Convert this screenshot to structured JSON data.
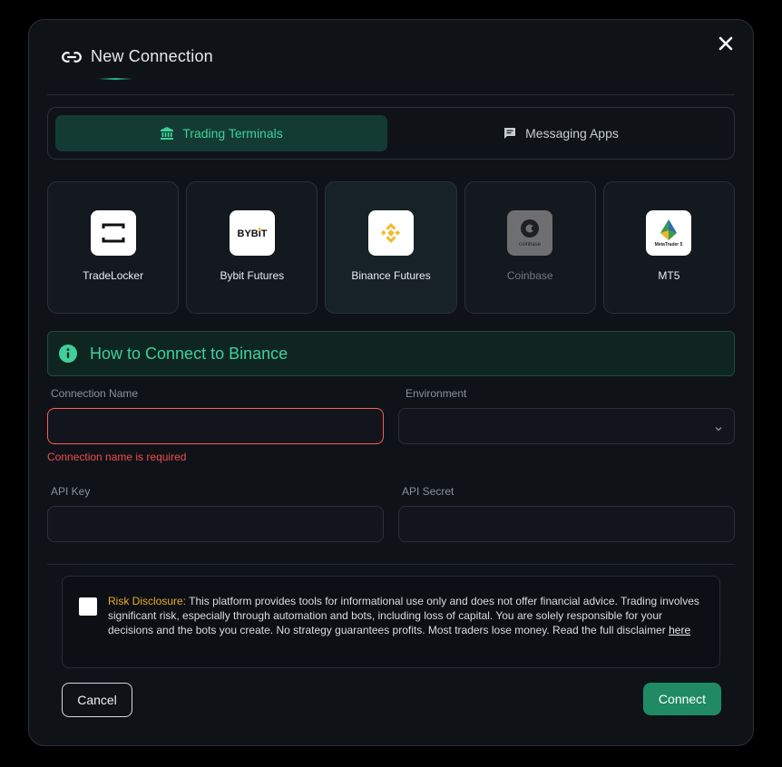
{
  "header": {
    "title": "New Connection",
    "link_icon": "link-icon",
    "close_icon": "close-icon"
  },
  "tabs": [
    {
      "label": "Trading Terminals",
      "icon": "bank-icon",
      "active": true
    },
    {
      "label": "Messaging Apps",
      "icon": "chat-icon",
      "active": false
    }
  ],
  "providers": [
    {
      "name": "TradeLocker",
      "logo": "tradelocker-logo",
      "selected": false,
      "disabled": false
    },
    {
      "name": "Bybit Futures",
      "logo": "bybit-logo",
      "logo_text": "BYBIT",
      "selected": false,
      "disabled": false
    },
    {
      "name": "Binance Futures",
      "logo": "binance-logo",
      "selected": true,
      "disabled": false
    },
    {
      "name": "Coinbase",
      "logo": "coinbase-logo",
      "logo_text": "coinbase",
      "selected": false,
      "disabled": true
    },
    {
      "name": "MT5",
      "logo": "metatrader-logo",
      "logo_text": "MetaTrader 5",
      "selected": false,
      "disabled": false
    }
  ],
  "info_banner": {
    "text": "How to Connect to Binance",
    "icon": "info-icon"
  },
  "form": {
    "connection_name": {
      "label": "Connection Name",
      "value": "",
      "error": "Connection name is required"
    },
    "environment": {
      "label": "Environment",
      "value": ""
    },
    "api_key": {
      "label": "API Key",
      "value": ""
    },
    "api_secret": {
      "label": "API Secret",
      "value": ""
    }
  },
  "disclaimer": {
    "label": "Risk Disclosure:",
    "text": " This platform provides tools for informational use only and does not offer financial advice. Trading involves significant risk, especially through automation and bots, including loss of capital. You are solely responsible for your decisions and the bots you create. No strategy guarantees profits. Most traders lose money. Read the full disclaimer ",
    "link": "here",
    "checked": false
  },
  "buttons": {
    "cancel": "Cancel",
    "connect": "Connect"
  },
  "colors": {
    "accent": "#3fd09c",
    "error": "#f04b4b",
    "warning": "#f0a92c",
    "primary_button": "#1f8a63"
  }
}
